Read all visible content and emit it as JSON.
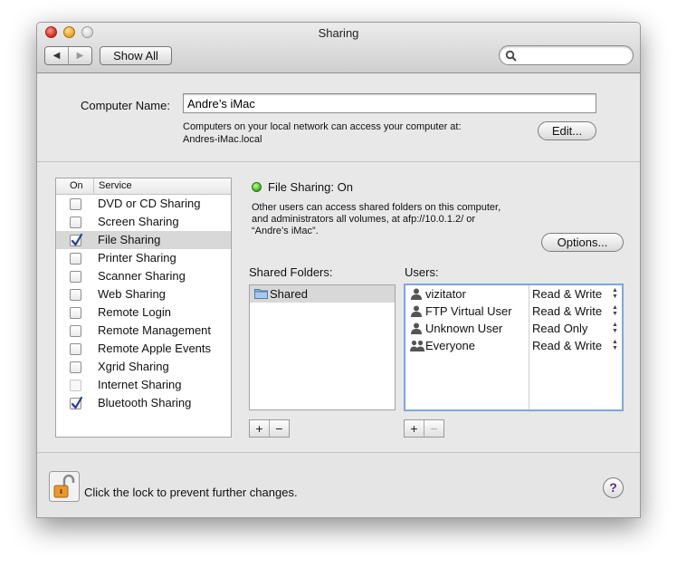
{
  "window": {
    "title": "Sharing"
  },
  "toolbar": {
    "back_glyph": "◀",
    "forward_glyph": "▶",
    "show_all_label": "Show All",
    "search_placeholder": ""
  },
  "computer_name": {
    "label": "Computer Name:",
    "value": "Andre’s iMac",
    "note_line1": "Computers on your local network can access your computer at:",
    "note_line2": "Andres-iMac.local",
    "edit_label": "Edit..."
  },
  "services": {
    "header_on": "On",
    "header_service": "Service",
    "items": [
      {
        "label": "DVD or CD Sharing",
        "checked": false,
        "selected": false,
        "disabled": false
      },
      {
        "label": "Screen Sharing",
        "checked": false,
        "selected": false,
        "disabled": false
      },
      {
        "label": "File Sharing",
        "checked": true,
        "selected": true,
        "disabled": false
      },
      {
        "label": "Printer Sharing",
        "checked": false,
        "selected": false,
        "disabled": false
      },
      {
        "label": "Scanner Sharing",
        "checked": false,
        "selected": false,
        "disabled": false
      },
      {
        "label": "Web Sharing",
        "checked": false,
        "selected": false,
        "disabled": false
      },
      {
        "label": "Remote Login",
        "checked": false,
        "selected": false,
        "disabled": false
      },
      {
        "label": "Remote Management",
        "checked": false,
        "selected": false,
        "disabled": false
      },
      {
        "label": "Remote Apple Events",
        "checked": false,
        "selected": false,
        "disabled": false
      },
      {
        "label": "Xgrid Sharing",
        "checked": false,
        "selected": false,
        "disabled": false
      },
      {
        "label": "Internet Sharing",
        "checked": false,
        "selected": false,
        "disabled": true
      },
      {
        "label": "Bluetooth Sharing",
        "checked": true,
        "selected": false,
        "disabled": false
      }
    ]
  },
  "detail": {
    "status": "File Sharing: On",
    "status_color": "#3fb41e",
    "desc_line1": "Other users can access shared folders on this computer,",
    "desc_line2": "and administrators all volumes, at afp://10.0.1.2/ or",
    "desc_line3": "“Andre’s iMac”.",
    "options_label": "Options..."
  },
  "shared_folders": {
    "label": "Shared Folders:",
    "items": [
      {
        "name": "Shared",
        "icon": "folder-icon"
      }
    ]
  },
  "users": {
    "label": "Users:",
    "items": [
      {
        "name": "vizitator",
        "permission": "Read & Write",
        "icon": "user-icon"
      },
      {
        "name": "FTP Virtual User",
        "permission": "Read & Write",
        "icon": "user-icon"
      },
      {
        "name": "Unknown User",
        "permission": "Read Only",
        "icon": "user-icon"
      },
      {
        "name": "Everyone",
        "permission": "Read & Write",
        "icon": "group-icon"
      }
    ]
  },
  "buttons": {
    "plus": "+",
    "minus": "−"
  },
  "footer": {
    "lock_text": "Click the lock to prevent further changes.",
    "help_label": "?"
  }
}
